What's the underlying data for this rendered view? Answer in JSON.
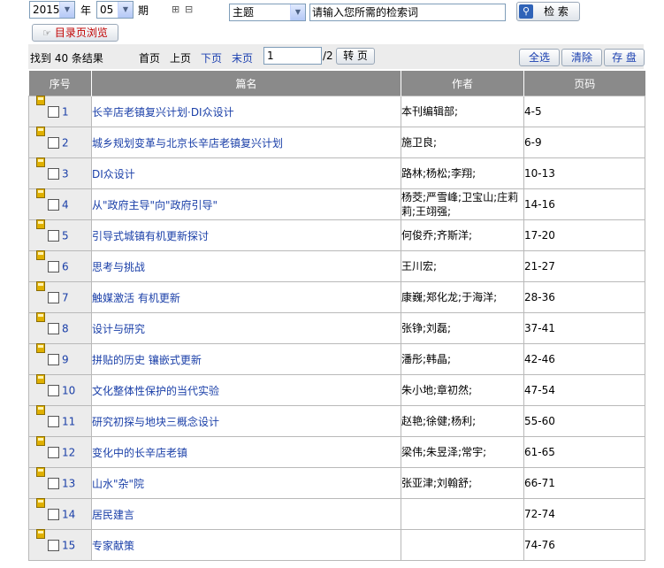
{
  "filters": {
    "year": "2015",
    "year_label": "年",
    "issue": "05",
    "issue_label": "期",
    "expand_icon": "⊞",
    "collapse_icon": "⊟",
    "field": "主题",
    "search_placeholder": "请输入您所需的检索词",
    "search_button": "检 索",
    "toc_button": "目录页浏览"
  },
  "toolbar": {
    "result_count": "找到 40 条结果",
    "first": "首页",
    "prev": "上页",
    "next": "下页",
    "last": "末页",
    "page_value": "1",
    "page_total": "/2",
    "go": "转 页",
    "select_all": "全选",
    "clear": "清除",
    "save": "存 盘"
  },
  "table": {
    "headers": [
      "序号",
      "篇名",
      "作者",
      "页码"
    ],
    "rows": [
      {
        "n": "1",
        "title": "长辛店老镇复兴计划·DI众设计",
        "author": "本刊编辑部;",
        "pages": "4-5"
      },
      {
        "n": "2",
        "title": "城乡规划变革与北京长辛店老镇复兴计划",
        "author": "施卫良;",
        "pages": "6-9"
      },
      {
        "n": "3",
        "title": "DI众设计",
        "author": "路林;杨松;李翔;",
        "pages": "10-13"
      },
      {
        "n": "4",
        "title": "从\"政府主导\"向\"政府引导\"",
        "author": "杨茭;严雪峰;卫宝山;庄莉莉;王翊强;",
        "pages": "14-16"
      },
      {
        "n": "5",
        "title": "引导式城镇有机更新探讨",
        "author": "何俊乔;齐斯洋;",
        "pages": "17-20"
      },
      {
        "n": "6",
        "title": "思考与挑战",
        "author": "王川宏;",
        "pages": "21-27"
      },
      {
        "n": "7",
        "title": "触媒激活 有机更新",
        "author": "康巍;郑化龙;于海洋;",
        "pages": "28-36"
      },
      {
        "n": "8",
        "title": "设计与研究",
        "author": "张铮;刘磊;",
        "pages": "37-41"
      },
      {
        "n": "9",
        "title": "拼贴的历史 镶嵌式更新",
        "author": "潘彤;韩晶;",
        "pages": "42-46"
      },
      {
        "n": "10",
        "title": "文化整体性保护的当代实验",
        "author": "朱小地;章初然;",
        "pages": "47-54"
      },
      {
        "n": "11",
        "title": "研究初探与地块三概念设计",
        "author": "赵艳;徐健;杨利;",
        "pages": "55-60"
      },
      {
        "n": "12",
        "title": "变化中的长辛店老镇",
        "author": "梁伟;朱昱泽;常宇;",
        "pages": "61-65"
      },
      {
        "n": "13",
        "title": "山水\"杂\"院",
        "author": "张亚津;刘翰舒;",
        "pages": "66-71"
      },
      {
        "n": "14",
        "title": "居民建言",
        "author": "",
        "pages": "72-74"
      },
      {
        "n": "15",
        "title": "专家献策",
        "author": "",
        "pages": "74-76"
      }
    ]
  }
}
